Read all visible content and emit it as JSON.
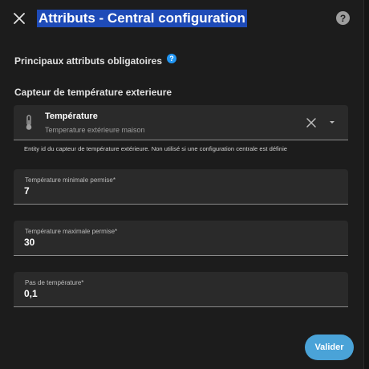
{
  "dialog": {
    "title": "Attributs - Central configuration",
    "help_glyph": "?",
    "close_icon": "close-icon",
    "help_icon": "help-icon"
  },
  "section": {
    "title": "Principaux attributs obligatoires",
    "info_glyph": "?"
  },
  "sensor": {
    "label": "Capteur de température exterieure",
    "entity_name": "Température",
    "entity_friendly": "Temperature extérieure maison",
    "icon": "thermometer-icon",
    "helper": "Entity id du capteur de température extérieure. Non utilisé si une configuration centrale est définie"
  },
  "fields": {
    "min_temp": {
      "label": "Température minimale permise*",
      "value": "7"
    },
    "max_temp": {
      "label": "Température maximale permise*",
      "value": "30"
    },
    "step": {
      "label": "Pas de température*",
      "value": "0,1"
    }
  },
  "actions": {
    "submit_label": "Valider"
  },
  "colors": {
    "dialog_bg": "#1c1c1c",
    "field_bg": "#2a2a2a",
    "accent": "#4aa3d8",
    "title_highlight": "#1e4bb8",
    "info": "#2196f3"
  }
}
